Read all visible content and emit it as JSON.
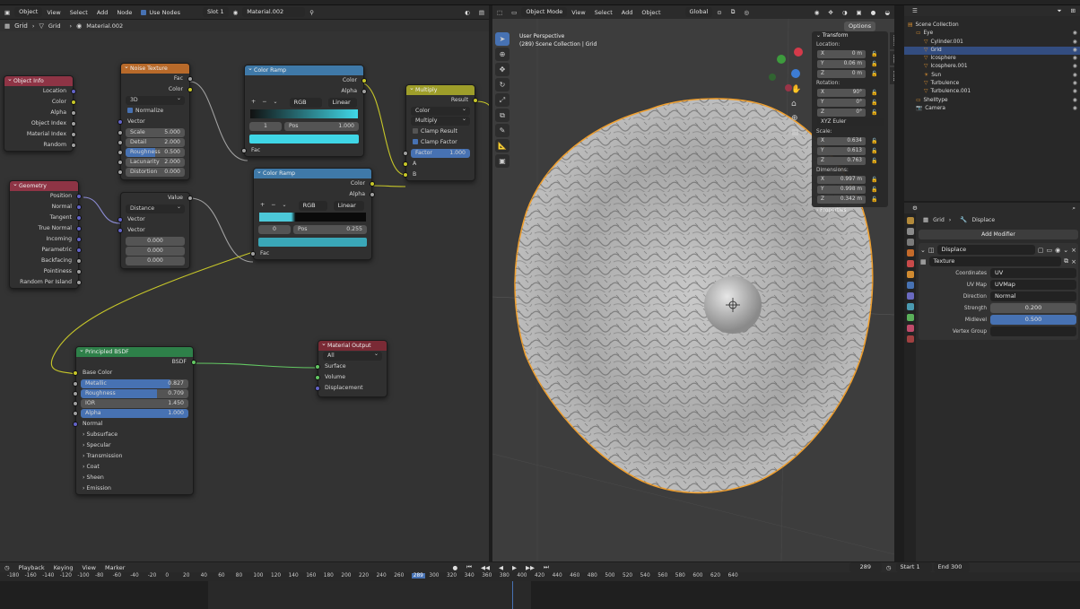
{
  "colors": {
    "accent": "#4772b3",
    "selection_orange": "#f0a030",
    "input": "#8e3445",
    "texture": "#b86a2a",
    "converter": "#3f79a8",
    "color": "#9e9e2a",
    "shader": "#2e8049",
    "output": "#7a2a35"
  },
  "node_editor": {
    "header": {
      "mode": "Object",
      "view": "View",
      "select": "Select",
      "add": "Add",
      "node": "Node",
      "use_nodes": "Use Nodes",
      "slot": "Slot 1",
      "material": "Material.002"
    },
    "breadcrumb": {
      "object": "Grid",
      "mesh": "Grid",
      "material": "Material.002"
    },
    "object_info": {
      "title": "Object Info",
      "outputs": [
        "Location",
        "Color",
        "Alpha",
        "Object Index",
        "Material Index",
        "Random"
      ]
    },
    "geometry": {
      "title": "Geometry",
      "outputs": [
        "Position",
        "Normal",
        "Tangent",
        "True Normal",
        "Incoming",
        "Parametric",
        "Backfacing",
        "Pointiness",
        "Random Per Island"
      ]
    },
    "noise": {
      "title": "Noise Texture",
      "outputs": [
        "Fac",
        "Color"
      ],
      "dim": "3D",
      "normalize": "Normalize",
      "vector": "Vector",
      "fields": [
        {
          "label": "Scale",
          "value": "5.000"
        },
        {
          "label": "Detail",
          "value": "2.000"
        },
        {
          "label": "Roughness",
          "value": "0.500"
        },
        {
          "label": "Lacunarity",
          "value": "2.000"
        },
        {
          "label": "Distortion",
          "value": "0.000"
        }
      ]
    },
    "distance": {
      "output": "Value",
      "mode": "Distance",
      "inputs": [
        "Vector",
        "Vector"
      ],
      "values": [
        "0.000",
        "0.000",
        "0.000"
      ]
    },
    "ramp1": {
      "title": "Color Ramp",
      "outputs": [
        "Color",
        "Alpha"
      ],
      "plus": "+",
      "minus": "−",
      "more": "⌄",
      "color_mode": "RGB",
      "interp": "Linear",
      "index": "1",
      "pos_label": "Pos",
      "pos": "1.000",
      "input": "Fac"
    },
    "ramp2": {
      "title": "Color Ramp",
      "outputs": [
        "Color",
        "Alpha"
      ],
      "plus": "+",
      "minus": "−",
      "more": "⌄",
      "color_mode": "RGB",
      "interp": "Linear",
      "index": "0",
      "pos_label": "Pos",
      "pos": "0.255",
      "input": "Fac"
    },
    "multiply": {
      "title": "Multiply",
      "output": "Result",
      "type": "Color",
      "blend": "Multiply",
      "clamp_result": "Clamp Result",
      "clamp_factor": "Clamp Factor",
      "factor_label": "Factor",
      "factor": "1.000",
      "inputs": [
        "A",
        "B"
      ]
    },
    "bsdf": {
      "title": "Principled BSDF",
      "output": "BSDF",
      "base": "Base Color",
      "fields": [
        {
          "label": "Metallic",
          "value": "0.827",
          "fill": 0.83
        },
        {
          "label": "Roughness",
          "value": "0.709",
          "fill": 0.71
        },
        {
          "label": "IOR",
          "value": "1.450",
          "fill": 0
        },
        {
          "label": "Alpha",
          "value": "1.000",
          "fill": 1
        }
      ],
      "normal": "Normal",
      "sections": [
        "Subsurface",
        "Specular",
        "Transmission",
        "Coat",
        "Sheen",
        "Emission"
      ]
    },
    "output": {
      "title": "Material Output",
      "target": "All",
      "inputs": [
        "Surface",
        "Volume",
        "Displacement"
      ]
    }
  },
  "viewport": {
    "header": {
      "mode": "Object Mode",
      "view": "View",
      "select": "Select",
      "add": "Add",
      "object": "Object",
      "orientation": "Global",
      "options": "Options"
    },
    "info": [
      "User Perspective",
      "(289) Scene Collection | Grid"
    ],
    "tools": [
      "select-icon",
      "cursor-icon",
      "move-icon",
      "rotate-icon",
      "scale-icon",
      "transform-icon",
      "annotate-icon",
      "measure-icon",
      "add-cube-icon"
    ],
    "side_tabs": [
      "Item",
      "Tool",
      "View"
    ],
    "transform": {
      "title": "Transform",
      "location_label": "Location:",
      "location": [
        {
          "axis": "X",
          "value": "0 m"
        },
        {
          "axis": "Y",
          "value": "0.06 m"
        },
        {
          "axis": "Z",
          "value": "0 m"
        }
      ],
      "rotation_label": "Rotation:",
      "rotation": [
        {
          "axis": "X",
          "value": "90°"
        },
        {
          "axis": "Y",
          "value": "0°"
        },
        {
          "axis": "Z",
          "value": "0°"
        }
      ],
      "euler": "XYZ Euler",
      "scale_label": "Scale:",
      "scale": [
        {
          "axis": "X",
          "value": "0.634"
        },
        {
          "axis": "Y",
          "value": "0.613"
        },
        {
          "axis": "Z",
          "value": "0.763"
        }
      ],
      "dimensions_label": "Dimensions:",
      "dimensions": [
        {
          "axis": "X",
          "value": "0.997 m"
        },
        {
          "axis": "Y",
          "value": "0.998 m"
        },
        {
          "axis": "Z",
          "value": "0.342 m"
        }
      ],
      "properties": "Properties"
    }
  },
  "outliner": {
    "items": [
      {
        "name": "Scene Collection",
        "indent": 0,
        "selected": false
      },
      {
        "name": "Eye",
        "indent": 1,
        "selected": false
      },
      {
        "name": "Cylinder.001",
        "indent": 2,
        "selected": false
      },
      {
        "name": "Grid",
        "indent": 2,
        "selected": true
      },
      {
        "name": "Icosphere",
        "indent": 2,
        "selected": false
      },
      {
        "name": "Icosphere.001",
        "indent": 2,
        "selected": false
      },
      {
        "name": "Sun",
        "indent": 2,
        "selected": false
      },
      {
        "name": "Turbulence",
        "indent": 2,
        "selected": false
      },
      {
        "name": "Turbulence.001",
        "indent": 2,
        "selected": false
      },
      {
        "name": "Shelltype",
        "indent": 1,
        "selected": false
      },
      {
        "name": "Camera",
        "indent": 1,
        "selected": false
      }
    ]
  },
  "properties": {
    "breadcrumb_object": "Grid",
    "breadcrumb_mod": "Displace",
    "add_modifier": "Add Modifier",
    "modifier_name": "Displace",
    "texture": "Texture",
    "coordinates_label": "Coordinates",
    "coordinates": "UV",
    "uvmap_label": "UV Map",
    "uvmap": "UVMap",
    "direction_label": "Direction",
    "direction": "Normal",
    "strength_label": "Strength",
    "strength": "0.200",
    "midlevel_label": "Midlevel",
    "midlevel": "0.500",
    "vgroup_label": "Vertex Group"
  },
  "timeline": {
    "playback": "Playback",
    "keying": "Keying",
    "view": "View",
    "marker": "Marker",
    "current_frame": "289",
    "start_label": "Start",
    "start": "1",
    "end_label": "End",
    "end": "300",
    "ruler": [
      "-180",
      "-160",
      "-140",
      "-120",
      "-100",
      "-80",
      "-60",
      "-40",
      "-20",
      "0",
      "20",
      "40",
      "60",
      "80",
      "100",
      "120",
      "140",
      "160",
      "180",
      "200",
      "220",
      "240",
      "260",
      "289",
      "300",
      "320",
      "340",
      "360",
      "380",
      "400",
      "420",
      "440",
      "460",
      "480",
      "500",
      "520",
      "540",
      "560",
      "580",
      "600",
      "620",
      "640"
    ]
  }
}
